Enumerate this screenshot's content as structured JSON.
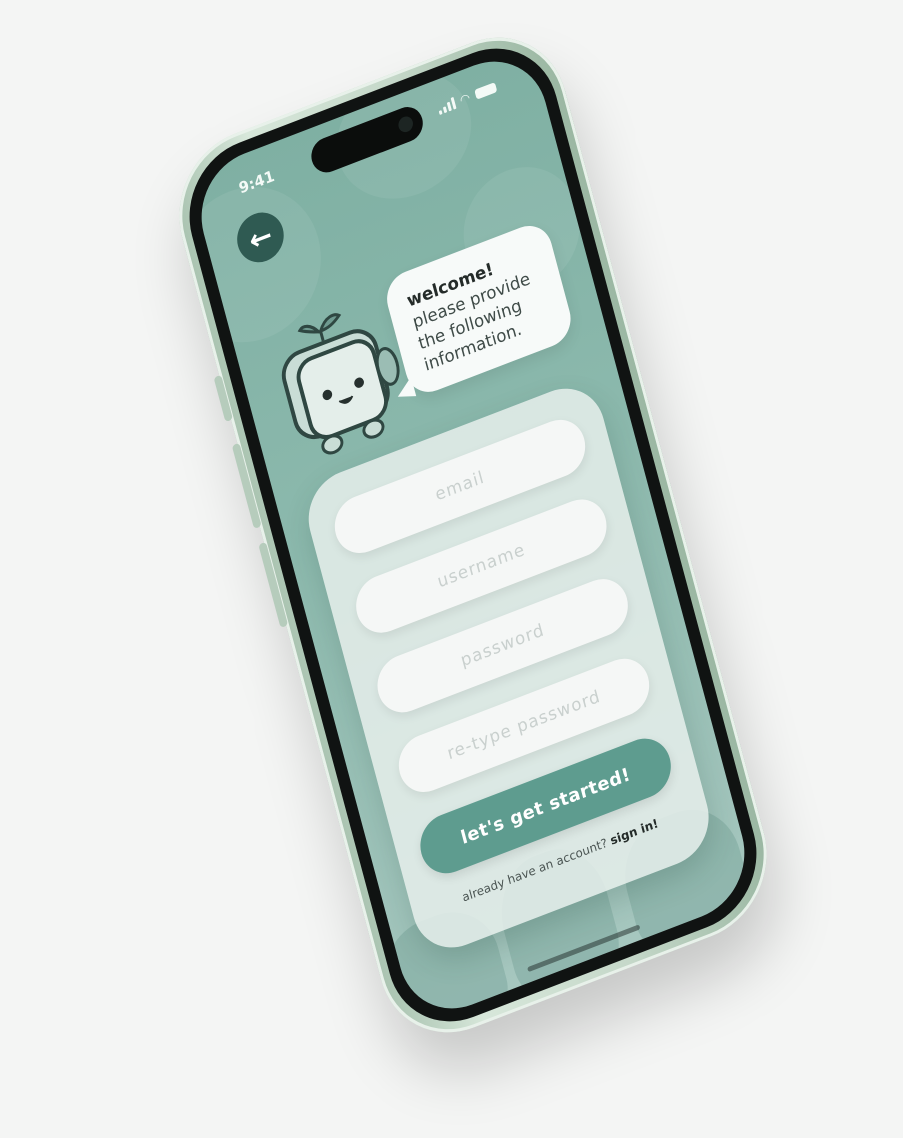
{
  "status_bar": {
    "time": "9:41"
  },
  "icons": {
    "back": "arrow-left-icon",
    "signal": "cellular-signal-icon",
    "wifi": "wifi-icon",
    "battery": "battery-icon",
    "mascot": "robot-mascot-icon"
  },
  "bubble": {
    "title": "welcome!",
    "message": "please provide the following information."
  },
  "form": {
    "email_placeholder": "email",
    "username_placeholder": "username",
    "password_placeholder": "password",
    "retype_password_placeholder": "re-type password",
    "submit_label": "let's get started!",
    "signin_prompt": "already have an account?",
    "signin_link": "sign in!"
  },
  "colors": {
    "background": "#7fb0a3",
    "accent": "#5e9c8f",
    "back_button": "#2f5a52",
    "card": "#e6eeeb"
  }
}
